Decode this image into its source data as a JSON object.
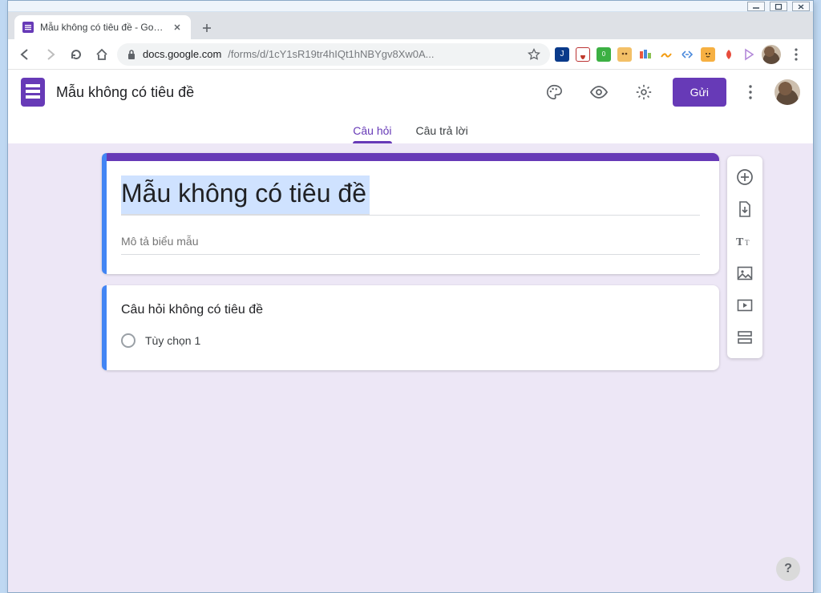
{
  "window": {
    "controls": {
      "min": "—",
      "max": "☐",
      "close": "✕"
    }
  },
  "browser": {
    "tab_title": "Mẫu không có tiêu đề - Google B",
    "address_domain": "docs.google.com",
    "address_path": "/forms/d/1cY1sR19tr4hIQt1hNBYgv8Xw0A...",
    "new_tab": "+",
    "star": "☆"
  },
  "header": {
    "form_name": "Mẫu không có tiêu đề",
    "send_label": "Gửi"
  },
  "tabs": {
    "questions": "Câu hỏi",
    "responses": "Câu trả lời"
  },
  "form": {
    "title": "Mẫu không có tiêu đề",
    "description_placeholder": "Mô tả biểu mẫu",
    "question_title": "Câu hỏi không có tiêu đề",
    "option_1": "Tùy chọn 1"
  },
  "help": "?"
}
